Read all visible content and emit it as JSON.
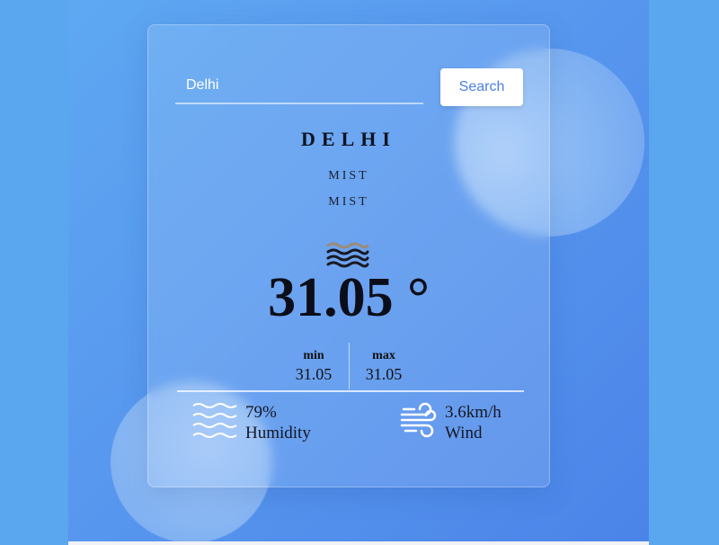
{
  "search": {
    "value": "Delhi",
    "button_label": "Search"
  },
  "weather": {
    "city": "DELHI",
    "condition_main": "MIST",
    "condition_desc": "MIST",
    "icon": "mist-icon",
    "temperature": "31.05 °",
    "min_label": "min",
    "min_value": "31.05",
    "max_label": "max",
    "max_value": "31.05"
  },
  "details": {
    "humidity_value": "79%",
    "humidity_label": "Humidity",
    "wind_value": "3.6km/h",
    "wind_label": "Wind"
  },
  "colors": {
    "background": "#5aa6ef",
    "button_text": "#4c7fe0",
    "card": "rgba(255,255,255,0.12)"
  }
}
